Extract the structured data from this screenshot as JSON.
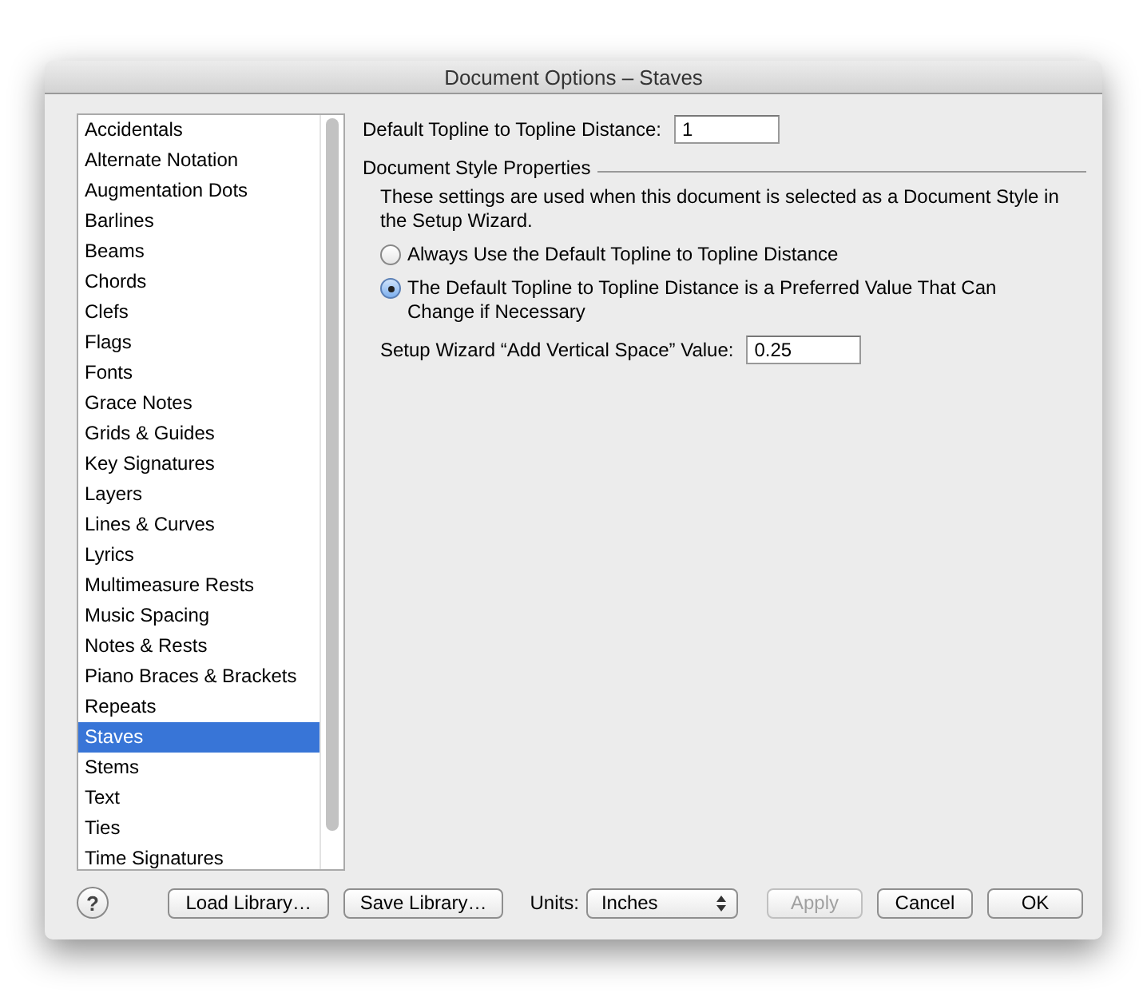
{
  "window": {
    "title": "Document Options – Staves"
  },
  "sidebar": {
    "items": [
      {
        "label": "Accidentals",
        "selected": false
      },
      {
        "label": "Alternate Notation",
        "selected": false
      },
      {
        "label": "Augmentation Dots",
        "selected": false
      },
      {
        "label": "Barlines",
        "selected": false
      },
      {
        "label": "Beams",
        "selected": false
      },
      {
        "label": "Chords",
        "selected": false
      },
      {
        "label": "Clefs",
        "selected": false
      },
      {
        "label": "Flags",
        "selected": false
      },
      {
        "label": "Fonts",
        "selected": false
      },
      {
        "label": "Grace Notes",
        "selected": false
      },
      {
        "label": "Grids & Guides",
        "selected": false
      },
      {
        "label": "Key Signatures",
        "selected": false
      },
      {
        "label": "Layers",
        "selected": false
      },
      {
        "label": "Lines & Curves",
        "selected": false
      },
      {
        "label": "Lyrics",
        "selected": false
      },
      {
        "label": "Multimeasure Rests",
        "selected": false
      },
      {
        "label": "Music Spacing",
        "selected": false
      },
      {
        "label": "Notes & Rests",
        "selected": false
      },
      {
        "label": "Piano Braces & Brackets",
        "selected": false
      },
      {
        "label": "Repeats",
        "selected": false
      },
      {
        "label": "Staves",
        "selected": true
      },
      {
        "label": "Stems",
        "selected": false
      },
      {
        "label": "Text",
        "selected": false
      },
      {
        "label": "Ties",
        "selected": false
      },
      {
        "label": "Time Signatures",
        "selected": false
      }
    ]
  },
  "topline_distance": {
    "label": "Default Topline to Topline Distance:",
    "value": "1"
  },
  "document_style": {
    "title": "Document Style Properties",
    "description": "These settings are used when this document is selected as a Document Style in the Setup Wizard.",
    "options": [
      {
        "label": "Always Use the Default Topline to Topline Distance",
        "selected": false
      },
      {
        "label": "The Default Topline to Topline Distance is a Preferred Value That Can Change if Necessary",
        "selected": true
      }
    ],
    "vertical_space": {
      "label": "Setup Wizard “Add Vertical Space” Value:",
      "value": "0.25"
    }
  },
  "footer": {
    "help": "?",
    "load": "Load Library…",
    "save": "Save Library…",
    "units_label": "Units:",
    "units_value": "Inches",
    "buttons": [
      {
        "label": "Apply",
        "disabled": true
      },
      {
        "label": "Cancel",
        "disabled": false
      },
      {
        "label": "OK",
        "disabled": false
      }
    ]
  }
}
